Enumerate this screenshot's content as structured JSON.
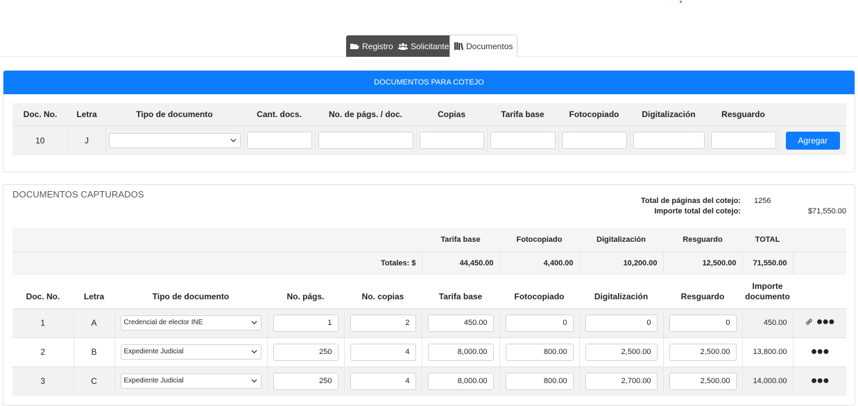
{
  "tabs": [
    {
      "label": "Registro",
      "icon": "folder-open-icon"
    },
    {
      "label": "Solicitante",
      "icon": "users-icon"
    },
    {
      "label": "Documentos",
      "icon": "books-icon"
    }
  ],
  "captura": {
    "header": "DOCUMENTOS PARA COTEJO",
    "columns": [
      "Doc. No.",
      "Letra",
      "Tipo de documento",
      "Cant. docs.",
      "No. de págs. / doc.",
      "Copias",
      "Tarifa base",
      "Fotocopiado",
      "Digitalización",
      "Resguardo"
    ],
    "doc_no": "10",
    "letra": "J",
    "tipo_value": "",
    "cant_docs": "",
    "paginas": "",
    "copias": "",
    "tarifa": "",
    "fotocopiado": "",
    "digitalizacion": "",
    "resguardo": "",
    "add_label": "Agregar"
  },
  "capturados": {
    "title": "DOCUMENTOS CAPTURADOS",
    "total_paginas_label": "Total de páginas del cotejo:",
    "total_paginas": "1256",
    "importe_total_label": "Importe total del cotejo:",
    "importe_total": "$71,550.00",
    "totals": {
      "columns": [
        "Tarifa base",
        "Fotocopiado",
        "Digitalización",
        "Resguardo",
        "TOTAL"
      ],
      "label": "Totales: $",
      "values": [
        "44,450.00",
        "4,400.00",
        "10,200.00",
        "12,500.00",
        "71,550.00"
      ]
    },
    "columns": [
      "Doc. No.",
      "Letra",
      "Tipo de documento",
      "No. págs.",
      "No. copias",
      "Tarifa base",
      "Fotocopiado",
      "Digitalización",
      "Resguardo",
      "Importe documento"
    ],
    "rows": [
      {
        "doc": "1",
        "letra": "A",
        "tipo": "Credencial de elector INE",
        "paginas": "1",
        "copias": "2",
        "tarifa": "450.00",
        "fotocopiado": "0",
        "digitalizacion": "0",
        "resguardo": "0",
        "importe": "450.00",
        "has_link": true
      },
      {
        "doc": "2",
        "letra": "B",
        "tipo": "Expediente Judicial",
        "paginas": "250",
        "copias": "4",
        "tarifa": "8,000.00",
        "fotocopiado": "800.00",
        "digitalizacion": "2,500.00",
        "resguardo": "2,500.00",
        "importe": "13,800.00",
        "has_link": false
      },
      {
        "doc": "3",
        "letra": "C",
        "tipo": "Expediente Judicial",
        "paginas": "250",
        "copias": "4",
        "tarifa": "8,000.00",
        "fotocopiado": "800.00",
        "digitalizacion": "2,700.00",
        "resguardo": "2,500.00",
        "importe": "14,000.00",
        "has_link": false
      }
    ]
  }
}
